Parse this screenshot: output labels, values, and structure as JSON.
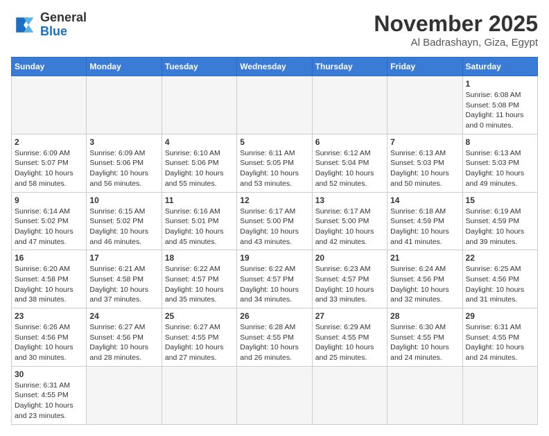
{
  "header": {
    "logo_general": "General",
    "logo_blue": "Blue",
    "month_title": "November 2025",
    "location": "Al Badrashayn, Giza, Egypt"
  },
  "weekdays": [
    "Sunday",
    "Monday",
    "Tuesday",
    "Wednesday",
    "Thursday",
    "Friday",
    "Saturday"
  ],
  "days": [
    {
      "num": "",
      "info": ""
    },
    {
      "num": "",
      "info": ""
    },
    {
      "num": "",
      "info": ""
    },
    {
      "num": "",
      "info": ""
    },
    {
      "num": "",
      "info": ""
    },
    {
      "num": "",
      "info": ""
    },
    {
      "num": "1",
      "info": "Sunrise: 6:08 AM\nSunset: 5:08 PM\nDaylight: 11 hours and 0 minutes."
    },
    {
      "num": "2",
      "info": "Sunrise: 6:09 AM\nSunset: 5:07 PM\nDaylight: 10 hours and 58 minutes."
    },
    {
      "num": "3",
      "info": "Sunrise: 6:09 AM\nSunset: 5:06 PM\nDaylight: 10 hours and 56 minutes."
    },
    {
      "num": "4",
      "info": "Sunrise: 6:10 AM\nSunset: 5:06 PM\nDaylight: 10 hours and 55 minutes."
    },
    {
      "num": "5",
      "info": "Sunrise: 6:11 AM\nSunset: 5:05 PM\nDaylight: 10 hours and 53 minutes."
    },
    {
      "num": "6",
      "info": "Sunrise: 6:12 AM\nSunset: 5:04 PM\nDaylight: 10 hours and 52 minutes."
    },
    {
      "num": "7",
      "info": "Sunrise: 6:13 AM\nSunset: 5:03 PM\nDaylight: 10 hours and 50 minutes."
    },
    {
      "num": "8",
      "info": "Sunrise: 6:13 AM\nSunset: 5:03 PM\nDaylight: 10 hours and 49 minutes."
    },
    {
      "num": "9",
      "info": "Sunrise: 6:14 AM\nSunset: 5:02 PM\nDaylight: 10 hours and 47 minutes."
    },
    {
      "num": "10",
      "info": "Sunrise: 6:15 AM\nSunset: 5:02 PM\nDaylight: 10 hours and 46 minutes."
    },
    {
      "num": "11",
      "info": "Sunrise: 6:16 AM\nSunset: 5:01 PM\nDaylight: 10 hours and 45 minutes."
    },
    {
      "num": "12",
      "info": "Sunrise: 6:17 AM\nSunset: 5:00 PM\nDaylight: 10 hours and 43 minutes."
    },
    {
      "num": "13",
      "info": "Sunrise: 6:17 AM\nSunset: 5:00 PM\nDaylight: 10 hours and 42 minutes."
    },
    {
      "num": "14",
      "info": "Sunrise: 6:18 AM\nSunset: 4:59 PM\nDaylight: 10 hours and 41 minutes."
    },
    {
      "num": "15",
      "info": "Sunrise: 6:19 AM\nSunset: 4:59 PM\nDaylight: 10 hours and 39 minutes."
    },
    {
      "num": "16",
      "info": "Sunrise: 6:20 AM\nSunset: 4:58 PM\nDaylight: 10 hours and 38 minutes."
    },
    {
      "num": "17",
      "info": "Sunrise: 6:21 AM\nSunset: 4:58 PM\nDaylight: 10 hours and 37 minutes."
    },
    {
      "num": "18",
      "info": "Sunrise: 6:22 AM\nSunset: 4:57 PM\nDaylight: 10 hours and 35 minutes."
    },
    {
      "num": "19",
      "info": "Sunrise: 6:22 AM\nSunset: 4:57 PM\nDaylight: 10 hours and 34 minutes."
    },
    {
      "num": "20",
      "info": "Sunrise: 6:23 AM\nSunset: 4:57 PM\nDaylight: 10 hours and 33 minutes."
    },
    {
      "num": "21",
      "info": "Sunrise: 6:24 AM\nSunset: 4:56 PM\nDaylight: 10 hours and 32 minutes."
    },
    {
      "num": "22",
      "info": "Sunrise: 6:25 AM\nSunset: 4:56 PM\nDaylight: 10 hours and 31 minutes."
    },
    {
      "num": "23",
      "info": "Sunrise: 6:26 AM\nSunset: 4:56 PM\nDaylight: 10 hours and 30 minutes."
    },
    {
      "num": "24",
      "info": "Sunrise: 6:27 AM\nSunset: 4:56 PM\nDaylight: 10 hours and 28 minutes."
    },
    {
      "num": "25",
      "info": "Sunrise: 6:27 AM\nSunset: 4:55 PM\nDaylight: 10 hours and 27 minutes."
    },
    {
      "num": "26",
      "info": "Sunrise: 6:28 AM\nSunset: 4:55 PM\nDaylight: 10 hours and 26 minutes."
    },
    {
      "num": "27",
      "info": "Sunrise: 6:29 AM\nSunset: 4:55 PM\nDaylight: 10 hours and 25 minutes."
    },
    {
      "num": "28",
      "info": "Sunrise: 6:30 AM\nSunset: 4:55 PM\nDaylight: 10 hours and 24 minutes."
    },
    {
      "num": "29",
      "info": "Sunrise: 6:31 AM\nSunset: 4:55 PM\nDaylight: 10 hours and 24 minutes."
    },
    {
      "num": "30",
      "info": "Sunrise: 6:31 AM\nSunset: 4:55 PM\nDaylight: 10 hours and 23 minutes."
    },
    {
      "num": "",
      "info": ""
    },
    {
      "num": "",
      "info": ""
    },
    {
      "num": "",
      "info": ""
    },
    {
      "num": "",
      "info": ""
    },
    {
      "num": "",
      "info": ""
    },
    {
      "num": "",
      "info": ""
    }
  ]
}
